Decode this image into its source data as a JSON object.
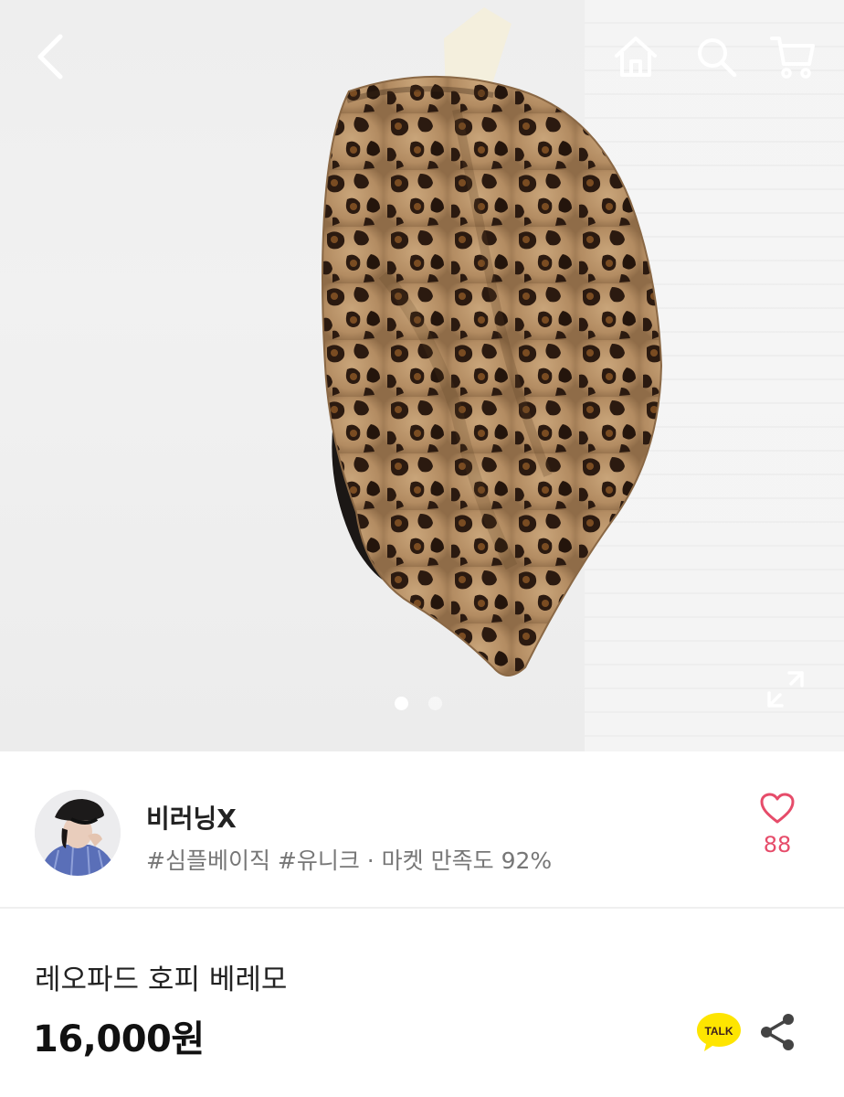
{
  "product": {
    "image_alt": "레오파드 호피 베레모",
    "image_count": 2,
    "active_image_index": 0,
    "name": "레오파드 호피 베레모",
    "price": "16,000원"
  },
  "seller": {
    "name": "비러닝X",
    "tags": "#심플베이직 #유니크 · 마켓 만족도 92%",
    "like_count": "88"
  },
  "share": {
    "talk_label": "TALK"
  },
  "icons": {
    "back": "chevron-left-icon",
    "home": "home-icon",
    "search": "search-icon",
    "cart": "cart-icon",
    "expand": "expand-icon",
    "like": "heart-icon",
    "talk": "kakao-talk-icon",
    "share": "share-icon"
  },
  "colors": {
    "accent": "#e64c6a",
    "talk_bg": "#fee500",
    "text_primary": "#222222",
    "text_secondary": "#777777"
  }
}
